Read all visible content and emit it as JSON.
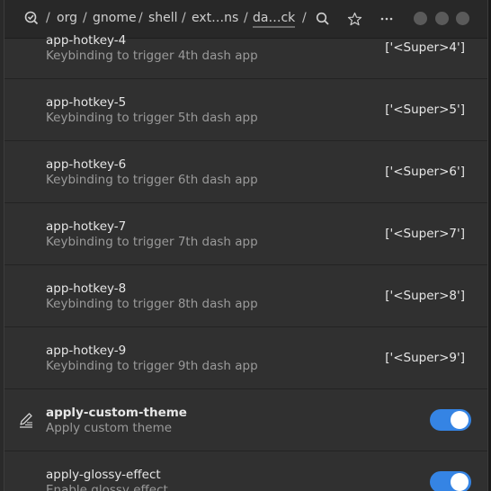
{
  "header": {
    "breadcrumbs": [
      "org",
      "gnome",
      "shell",
      "ext…ns",
      "da…ck"
    ],
    "separator": "/"
  },
  "rows": [
    {
      "name": "app-hotkey-4",
      "desc": "Keybinding to trigger 4th dash app",
      "value": "['<Super>4']"
    },
    {
      "name": "app-hotkey-5",
      "desc": "Keybinding to trigger 5th dash app",
      "value": "['<Super>5']"
    },
    {
      "name": "app-hotkey-6",
      "desc": "Keybinding to trigger 6th dash app",
      "value": "['<Super>6']"
    },
    {
      "name": "app-hotkey-7",
      "desc": "Keybinding to trigger 7th dash app",
      "value": "['<Super>7']"
    },
    {
      "name": "app-hotkey-8",
      "desc": "Keybinding to trigger 8th dash app",
      "value": "['<Super>8']"
    },
    {
      "name": "app-hotkey-9",
      "desc": "Keybinding to trigger 9th dash app",
      "value": "['<Super>9']"
    }
  ],
  "toggles": [
    {
      "name": "apply-custom-theme",
      "desc": "Apply custom theme",
      "on": true
    },
    {
      "name": "apply-glossy-effect",
      "desc": "Enable glossy effect",
      "on": true
    }
  ],
  "colors": {
    "accent": "#3584e4"
  }
}
